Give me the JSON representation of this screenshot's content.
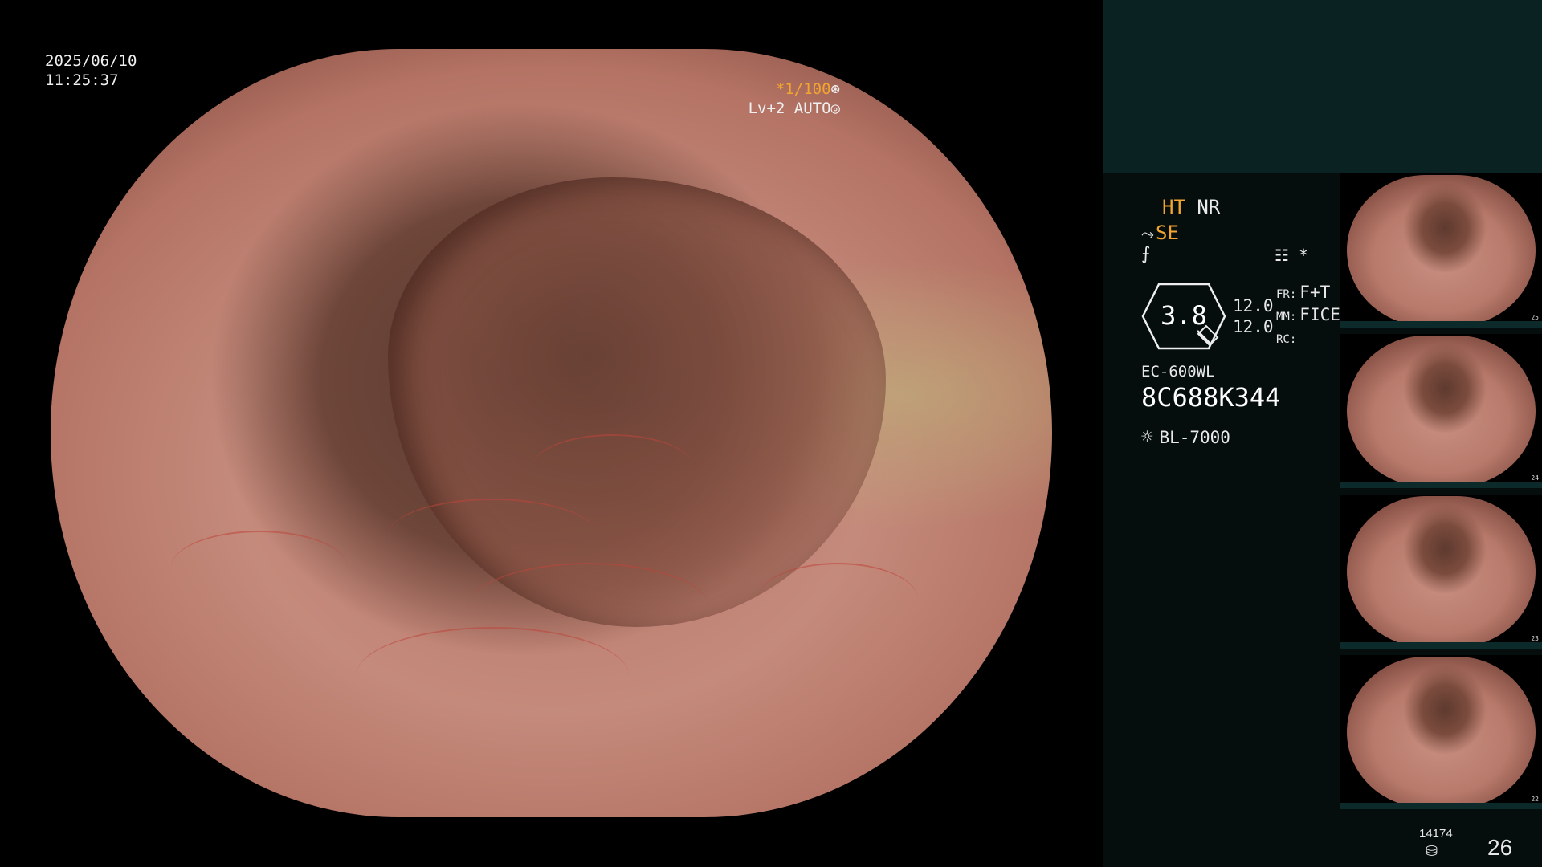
{
  "main": {
    "date": "2025/06/10",
    "time": "11:25:37",
    "shutter": "*1/100",
    "shutter_icon": "aperture-icon",
    "level": "Lv+2 AUTO",
    "auto_icon": "target-icon"
  },
  "panel": {
    "ht": "HT",
    "nr": "NR",
    "se": "SE",
    "se_icon": "pump-icon",
    "f_icon": "slash-f-icon",
    "settings_icon": "settings-icon",
    "star": "*",
    "zoom": "3.8",
    "val1": "12.0",
    "val2": "12.0",
    "fr_label": "FR:",
    "fr_value": "F+T",
    "mm_label": "MM:",
    "mm_value": "FICE",
    "rc_label": "RC:",
    "rc_value": "",
    "model": "EC-600WL",
    "serial": "8C688K344",
    "processor": "BL-7000",
    "processor_icon": "light-source-icon"
  },
  "thumbnails": [
    {
      "num": "25"
    },
    {
      "num": "24"
    },
    {
      "num": "23"
    },
    {
      "num": "22"
    }
  ],
  "footer": {
    "count": "14174",
    "db_icon": "database-icon",
    "page": "26"
  },
  "colors": {
    "accent": "#f2a530",
    "panel_bg": "#050d0d",
    "panel_top": "#0b2222"
  }
}
